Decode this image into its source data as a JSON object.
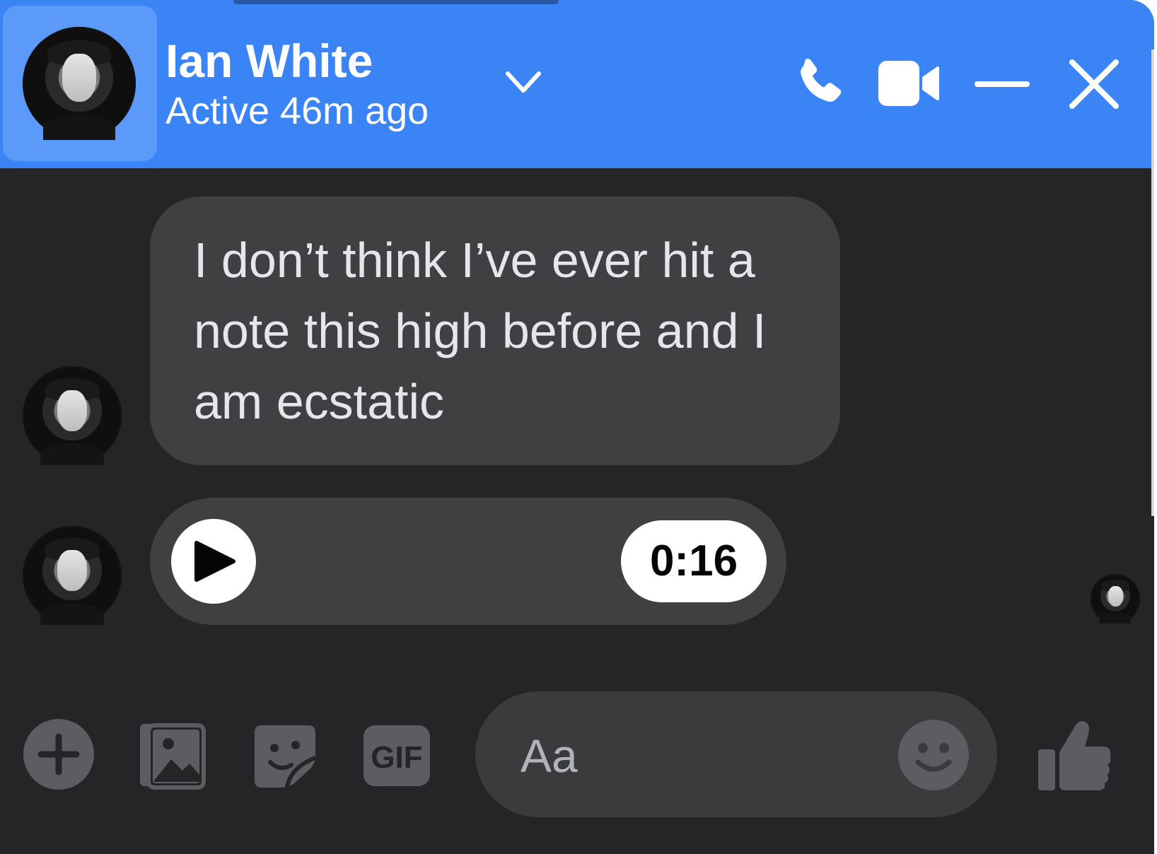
{
  "header": {
    "name": "Ian White",
    "status": "Active 46m ago",
    "icons": [
      "chevron-down-icon",
      "phone-icon",
      "video-camera-icon",
      "minimize-icon",
      "close-icon"
    ]
  },
  "messages": [
    {
      "type": "text",
      "text": "I don’t think I’ve ever hit a note this high before and I am ecstatic"
    },
    {
      "type": "audio",
      "duration": "0:16"
    }
  ],
  "composer": {
    "placeholder": "Aa",
    "icons": [
      "plus-icon",
      "image-icon",
      "sticker-icon",
      "gif-icon",
      "emoji-icon",
      "thumbs-up-icon"
    ]
  },
  "colors": {
    "header_bg": "#3b84f5",
    "window_bg": "#242526",
    "bubble_bg": "#3e4042",
    "icon_gray": "#5b5d60"
  }
}
